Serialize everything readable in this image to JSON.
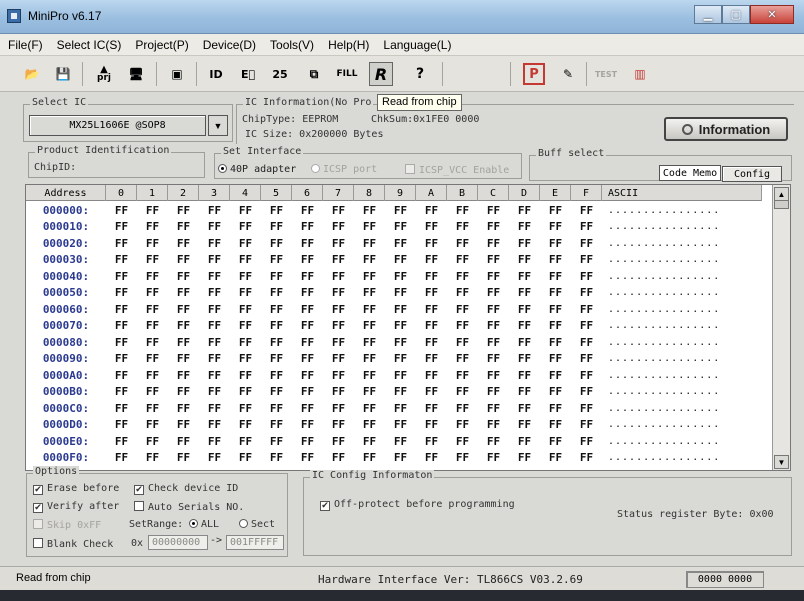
{
  "window": {
    "title": "MiniPro v6.17"
  },
  "menu": [
    "File(F)",
    "Select IC(S)",
    "Project(P)",
    "Device(D)",
    "Tools(V)",
    "Help(H)",
    "Language(L)"
  ],
  "toolbar": {
    "prj_label": "prj",
    "fill_label": "FILL",
    "read_label": "R",
    "help_label": "?",
    "p_label": "P",
    "test_label": "TEST",
    "tooltip": "Read from chip"
  },
  "select_ic": {
    "title": "Select IC",
    "value": "MX25L1606E @SOP8"
  },
  "ic_info": {
    "title": "IC Information(No Pro",
    "chip_type": "ChipType:  EEPROM",
    "chksum": "ChkSum:0x1FE0 0000",
    "ic_size": "IC Size:   0x200000 Bytes",
    "info_button": "Information"
  },
  "product_id": {
    "title": "Product Identification",
    "chip_id": "ChipID:"
  },
  "interface": {
    "title": "Set Interface",
    "opt1": "40P adapter",
    "opt2": "ICSP port",
    "opt3": "ICSP_VCC Enable"
  },
  "buff": {
    "title": "Buff select",
    "code_memo": "Code Memo",
    "config": "Config"
  },
  "grid": {
    "header_address": "Address",
    "columns": [
      "0",
      "1",
      "2",
      "3",
      "4",
      "5",
      "6",
      "7",
      "8",
      "9",
      "A",
      "B",
      "C",
      "D",
      "E",
      "F"
    ],
    "header_ascii": "ASCII",
    "rows": [
      "000000:",
      "000010:",
      "000020:",
      "000030:",
      "000040:",
      "000050:",
      "000060:",
      "000070:",
      "000080:",
      "000090:",
      "0000A0:",
      "0000B0:",
      "0000C0:",
      "0000D0:",
      "0000E0:",
      "0000F0:"
    ],
    "cell_value": "FF",
    "ascii_value": "................"
  },
  "options": {
    "title": "Options",
    "erase_before": "Erase before",
    "check_device_id": "Check device ID",
    "verify_after": "Verify after",
    "auto_serials": "Auto Serials NO.",
    "skip_0xff": "Skip 0xFF",
    "set_range": "SetRange:",
    "all": "ALL",
    "sect": "Sect",
    "blank_check": "Blank Check",
    "range_prefix": "0x",
    "range_start": "00000000",
    "range_arrow": "->",
    "range_end": "001FFFFF"
  },
  "ic_config": {
    "title": "IC Config Informaton",
    "off_protect": "Off-protect before programming",
    "status_register": "Status register Byte: 0x00"
  },
  "status": {
    "left": "Read from chip",
    "hardware": "Hardware Interface Ver: TL866CS V03.2.69",
    "right": "0000 0000"
  }
}
